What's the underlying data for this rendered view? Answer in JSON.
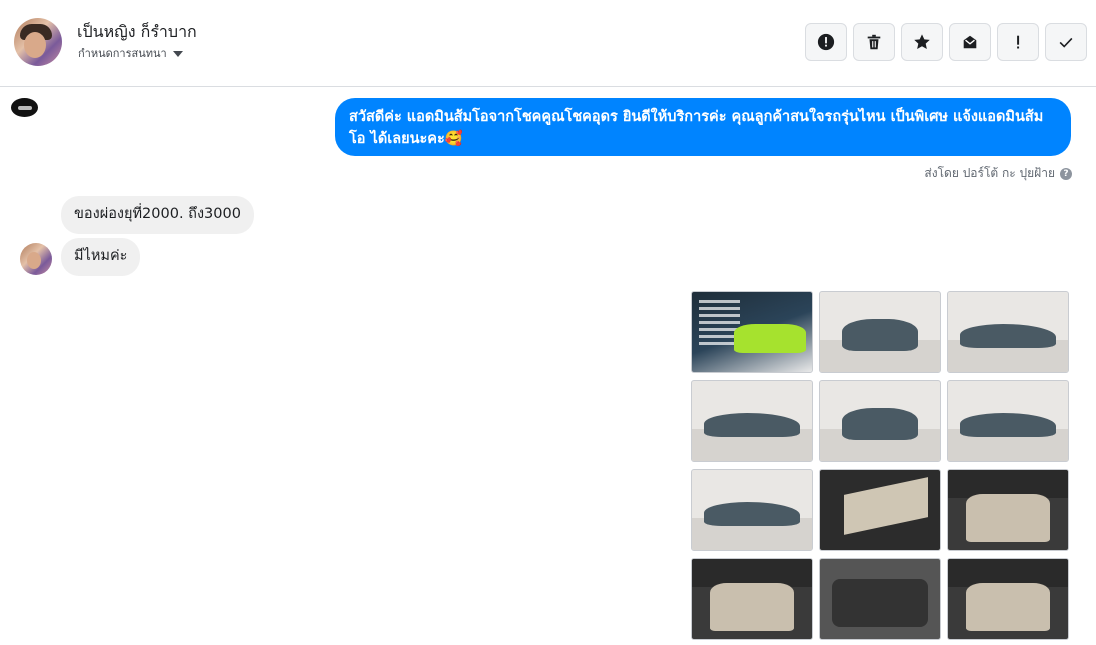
{
  "header": {
    "name": "เป็นหญิง ก็รำบาก",
    "subtitle": "กำหนดการสนทนา",
    "actions": [
      "alert-icon",
      "trash-icon",
      "star-icon",
      "mark-unread-icon",
      "exclamation-icon",
      "check-icon"
    ]
  },
  "messages": {
    "outgoing_text": "สวัสดีค่ะ แอดมินส้มโอจากโชคคูณโชคอุดร ยินดีให้บริการค่ะ   คุณลูกค้าสนใจรถรุ่นไหน เป็นพิเศษ แจ้งแอดมินส้มโอ ได้เลยนะคะ🥰",
    "sent_by": "ส่งโดย ปอร์โต้ กะ ปุยฝ้าย",
    "incoming": [
      "ของผ่องยุที่2000. ถึง3000",
      "มีไหมค่ะ"
    ]
  },
  "gallery": {
    "tile_count": 12,
    "tiles": [
      "promo",
      "car-front",
      "car-front-angle",
      "car-rear",
      "car-rear-center",
      "car-side-rear",
      "car-side",
      "door-interior",
      "interior-front",
      "interior-console",
      "engine-bay",
      "dashboard"
    ]
  },
  "colors": {
    "accent": "#0084ff",
    "incoming_bubble": "#f0f0f0"
  }
}
